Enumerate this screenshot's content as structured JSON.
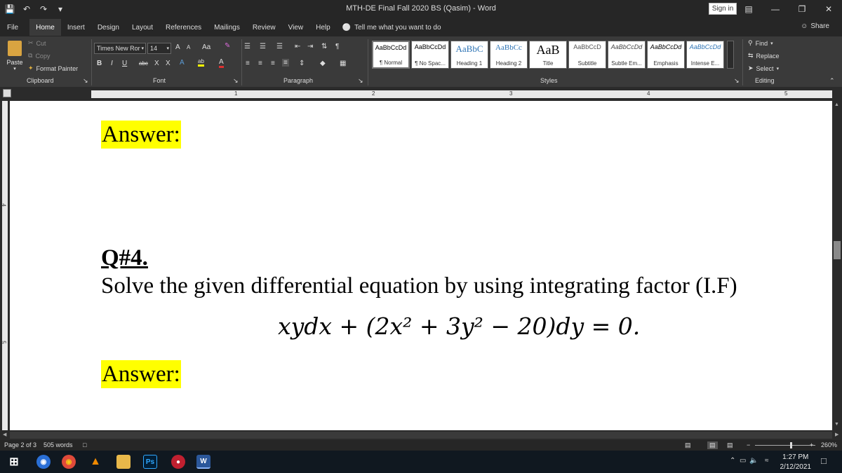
{
  "titlebar": {
    "title": "MTH-DE Final Fall 2020 BS (Qasim)  -  Word",
    "sign_in": "Sign in"
  },
  "tabs": [
    {
      "label": "File"
    },
    {
      "label": "Home"
    },
    {
      "label": "Insert"
    },
    {
      "label": "Design"
    },
    {
      "label": "Layout"
    },
    {
      "label": "References"
    },
    {
      "label": "Mailings"
    },
    {
      "label": "Review"
    },
    {
      "label": "View"
    },
    {
      "label": "Help"
    }
  ],
  "tell_me": "Tell me what you want to do",
  "share": "Share",
  "clipboard": {
    "paste": "Paste",
    "cut": "Cut",
    "copy": "Copy",
    "format_painter": "Format Painter",
    "label": "Clipboard"
  },
  "font": {
    "name": "Times New Ror",
    "size": "14",
    "label": "Font",
    "grow": "A",
    "shrink": "A",
    "case": "Aa",
    "bold": "B",
    "italic": "I",
    "underline": "U",
    "strike": "abc",
    "subscript": "X",
    "superscript": "X",
    "highlight_letters": "ab",
    "font_color": "A"
  },
  "paragraph": {
    "label": "Paragraph"
  },
  "styles": {
    "label": "Styles",
    "items": [
      {
        "sample": "AaBbCcDd",
        "name": "¶ Normal"
      },
      {
        "sample": "AaBbCcDd",
        "name": "¶ No Spac..."
      },
      {
        "sample": "AaBbC",
        "name": "Heading 1"
      },
      {
        "sample": "AaBbCc",
        "name": "Heading 2"
      },
      {
        "sample": "AaB",
        "name": "Title"
      },
      {
        "sample": "AaBbCcD",
        "name": "Subtitle"
      },
      {
        "sample": "AaBbCcDd",
        "name": "Subtle Em..."
      },
      {
        "sample": "AaBbCcDd",
        "name": "Emphasis"
      },
      {
        "sample": "AaBbCcDd",
        "name": "Intense E..."
      }
    ]
  },
  "editing": {
    "find": "Find",
    "replace": "Replace",
    "select": "Select",
    "label": "Editing"
  },
  "ruler": {
    "numbers": [
      "1",
      "2",
      "3",
      "4",
      "5"
    ],
    "v_numbers": [
      "4",
      "5"
    ]
  },
  "document": {
    "answer_1": "Answer:",
    "question_number": "Q#4.",
    "question_text": "Solve the given differential equation by using integrating factor (I.F)",
    "equation": "xydx + (2x² + 3y² − 20)dy = 0.",
    "answer_2": "Answer:"
  },
  "status": {
    "page": "Page 2 of 3",
    "words": "505 words",
    "zoom": "260%"
  },
  "taskbar": {
    "ps_label": "Ps",
    "word_label": "W",
    "time": "1:27 PM",
    "date": "2/12/2021"
  }
}
